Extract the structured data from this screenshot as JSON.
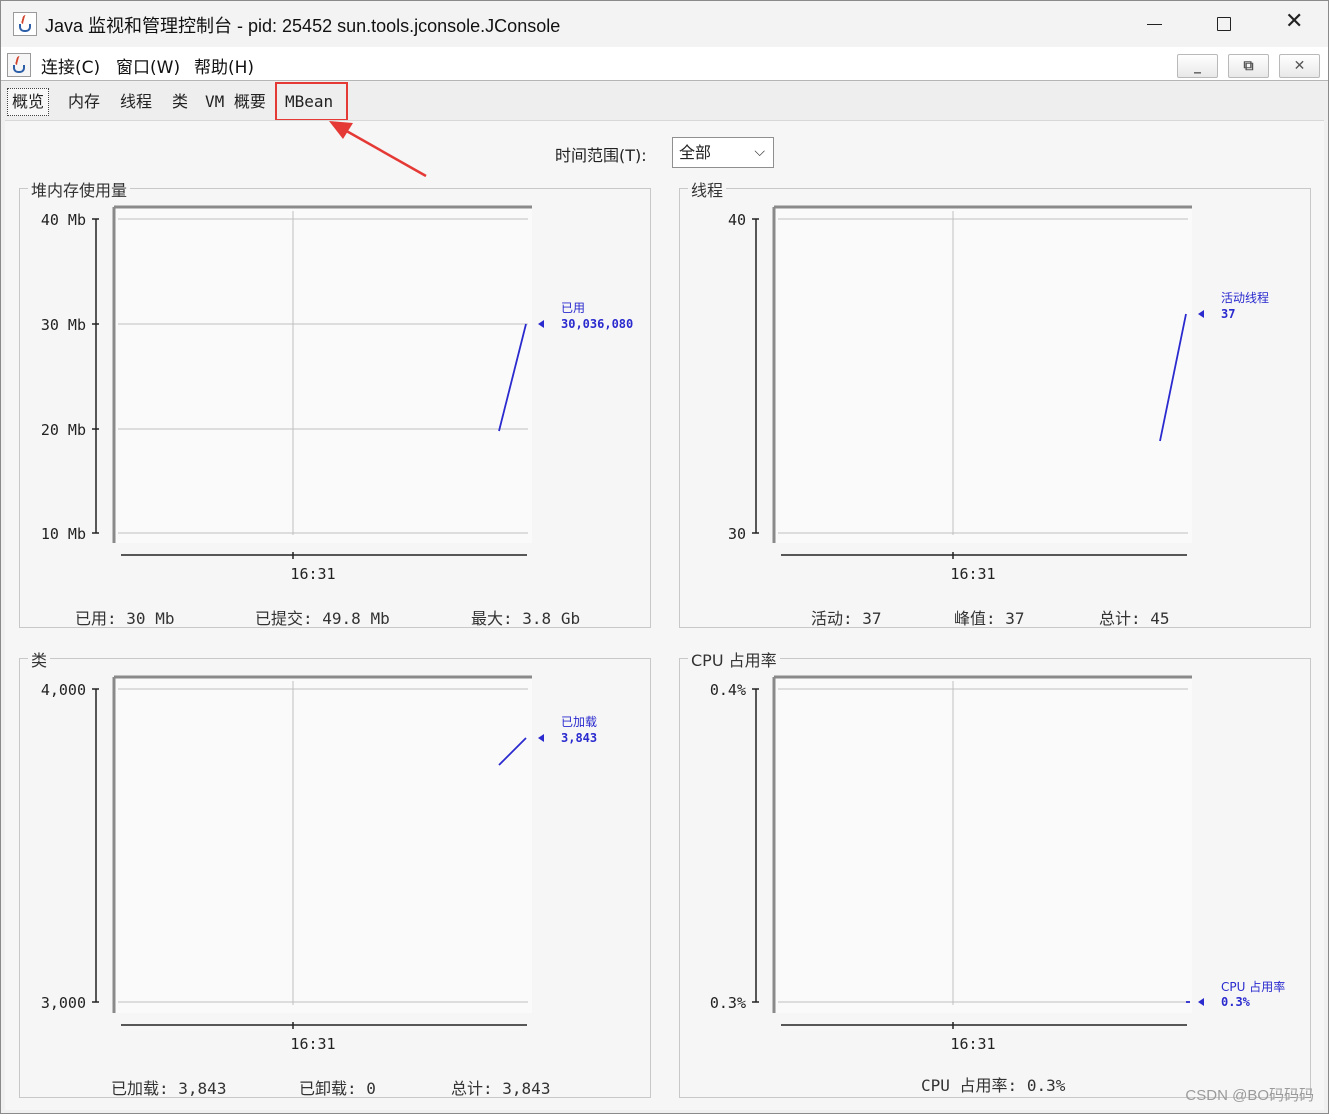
{
  "window": {
    "title": "Java 监视和管理控制台 - pid: 25452 sun.tools.jconsole.JConsole",
    "controls": {
      "minimize": "—",
      "maximize": "□",
      "close": "✕"
    }
  },
  "menu": {
    "items": [
      "连接(C)",
      "窗口(W)",
      "帮助(H)"
    ],
    "frame_buttons": [
      "_",
      "⧉",
      "✕"
    ]
  },
  "tabs": [
    {
      "label": "概览",
      "active": true
    },
    {
      "label": "内存"
    },
    {
      "label": "线程"
    },
    {
      "label": "类"
    },
    {
      "label": "VM 概要"
    },
    {
      "label": "MBean",
      "highlighted": true
    }
  ],
  "time_range": {
    "label": "时间范围(T):",
    "value": "全部"
  },
  "panels": {
    "heap": {
      "title": "堆内存使用量",
      "series_label": "已用",
      "series_value": "30,036,080",
      "y_ticks": [
        "40 Mb",
        "30 Mb",
        "20 Mb",
        "10 Mb"
      ],
      "x_tick": "16:31",
      "stats": [
        {
          "label": "已用:",
          "value": "30",
          "unit": "Mb"
        },
        {
          "label": "已提交:",
          "value": "49.8",
          "unit": "Mb"
        },
        {
          "label": "最大:",
          "value": "3.8",
          "unit": "Gb"
        }
      ]
    },
    "threads": {
      "title": "线程",
      "series_label": "活动线程",
      "series_value": "37",
      "y_ticks": [
        "40",
        "30"
      ],
      "x_tick": "16:31",
      "stats": [
        {
          "label": "活动:",
          "value": "37"
        },
        {
          "label": "峰值:",
          "value": "37"
        },
        {
          "label": "总计:",
          "value": "45"
        }
      ]
    },
    "classes": {
      "title": "类",
      "series_label": "已加载",
      "series_value": "3,843",
      "y_ticks": [
        "4,000",
        "3,000"
      ],
      "x_tick": "16:31",
      "stats": [
        {
          "label": "已加载:",
          "value": "3,843"
        },
        {
          "label": "已卸载:",
          "value": "0"
        },
        {
          "label": "总计:",
          "value": "3,843"
        }
      ]
    },
    "cpu": {
      "title": "CPU 占用率",
      "series_label": "CPU 占用率",
      "series_value": "0.3%",
      "y_ticks": [
        "0.4%",
        "0.3%"
      ],
      "x_tick": "16:31",
      "stats": [
        {
          "label": "CPU 占用率:",
          "value": "0.3%"
        }
      ]
    }
  },
  "colors": {
    "series": "#2a2acf",
    "highlight": "#e53935",
    "grid": "#c0c0c0",
    "connection": "#2e9e2e"
  },
  "watermark": "CSDN @BO码码码"
}
